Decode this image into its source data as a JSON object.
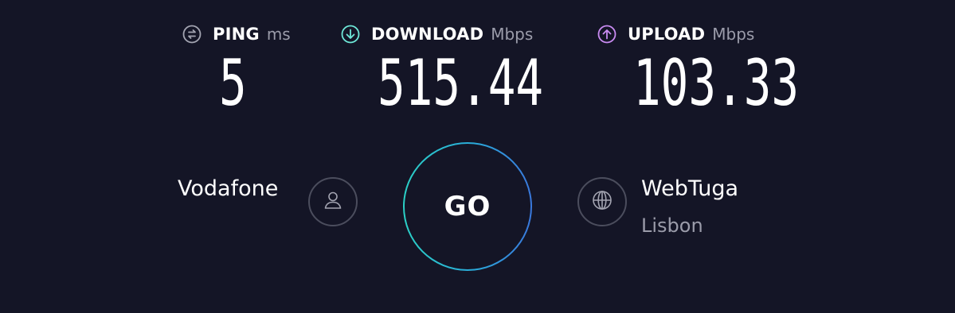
{
  "colors": {
    "background": "#141526",
    "ping_icon": "#a3a4b1",
    "download_icon": "#6ee8d8",
    "upload_icon": "#c98bf2",
    "unit_text": "#9b9caa",
    "go_ring_start": "#2bd0c6",
    "go_ring_end": "#3a78dd"
  },
  "results": {
    "ping": {
      "label": "PING",
      "unit": "ms",
      "value": "5",
      "icon": "ping-icon"
    },
    "download": {
      "label": "DOWNLOAD",
      "unit": "Mbps",
      "value": "515.44",
      "icon": "download-arrow-icon"
    },
    "upload": {
      "label": "UPLOAD",
      "unit": "Mbps",
      "value": "103.33",
      "icon": "upload-arrow-icon"
    }
  },
  "provider": {
    "name": "Vodafone",
    "icon": "user-icon"
  },
  "go_button": {
    "label": "GO"
  },
  "server": {
    "name": "WebTuga",
    "location": "Lisbon",
    "icon": "globe-icon"
  }
}
